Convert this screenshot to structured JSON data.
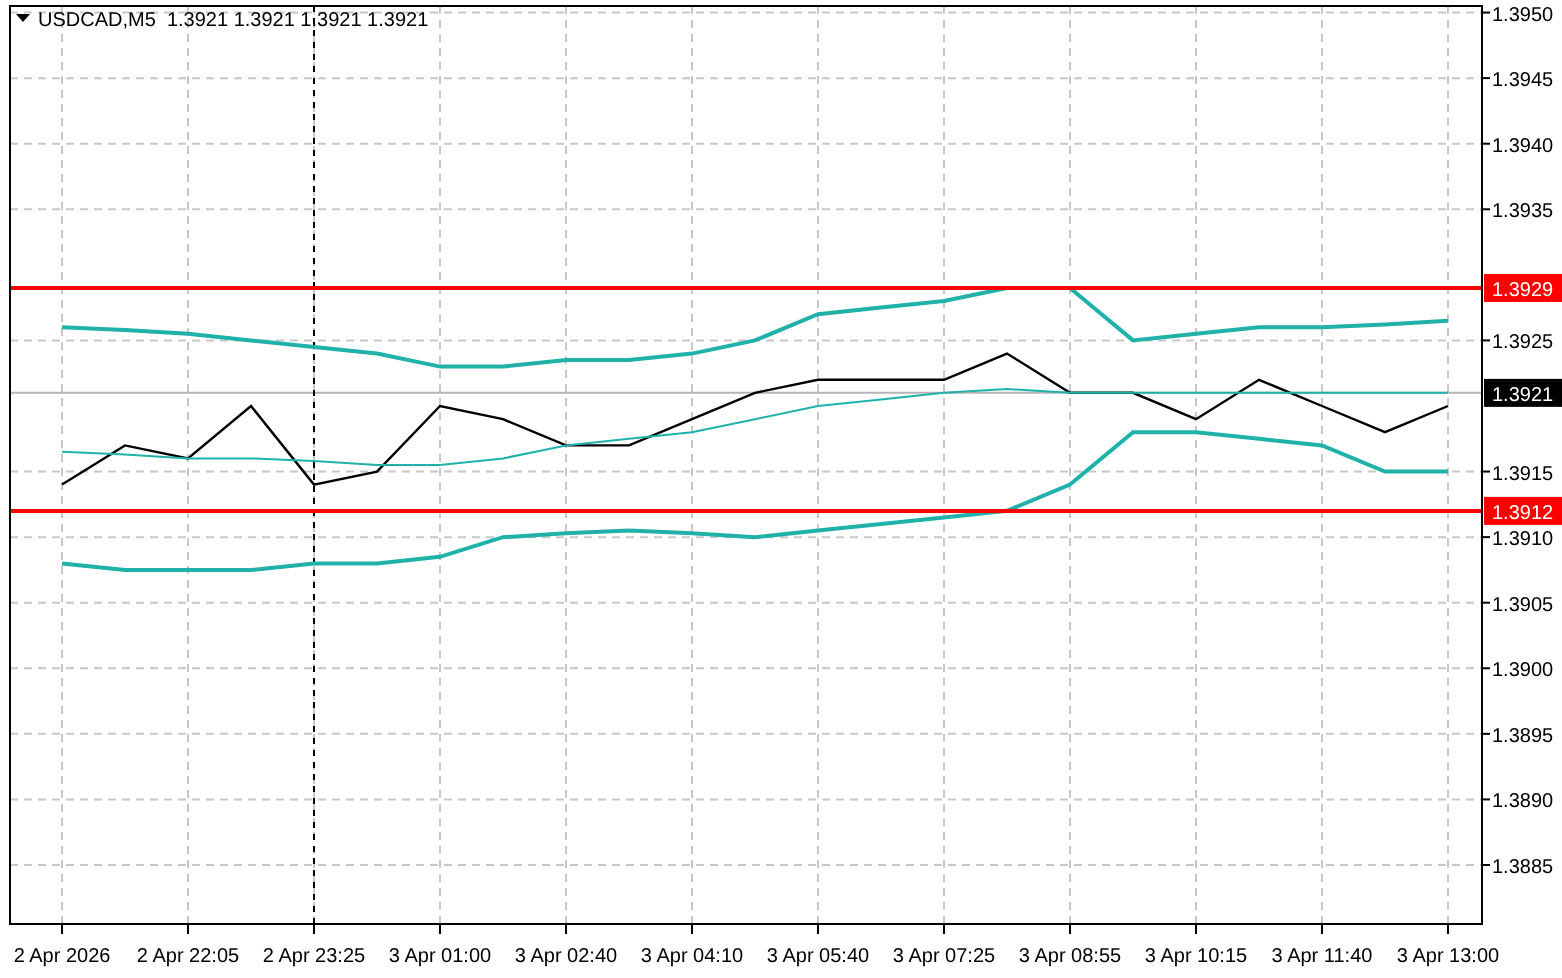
{
  "chart": {
    "header": {
      "symbol": "USDCAD,M5",
      "ohlc": [
        "1.3921",
        "1.3921",
        "1.3921",
        "1.3921"
      ]
    },
    "chart_data": {
      "type": "line",
      "categories": [
        "2 Apr 2026",
        null,
        "2 Apr 22:05",
        null,
        "2 Apr 23:25",
        null,
        "3 Apr 01:00",
        null,
        "3 Apr 02:40",
        null,
        "3 Apr 04:10",
        null,
        "3 Apr 05:40",
        null,
        "3 Apr 07:25",
        null,
        "3 Apr 08:55",
        null,
        "3 Apr 10:15",
        null,
        "3 Apr 11:40",
        null,
        "3 Apr 13:00"
      ],
      "ylim": [
        1.38805,
        1.39505
      ],
      "series": [
        {
          "color": "#000000",
          "values": [
            1.3914,
            1.3917,
            1.3916,
            1.392,
            1.3914,
            1.3915,
            1.392,
            1.3919,
            1.3917,
            1.3917,
            1.3919,
            1.3921,
            1.3922,
            1.3922,
            1.3922,
            1.3924,
            1.3921,
            1.3921,
            1.3919,
            1.3922,
            1.392,
            1.3918,
            1.392
          ]
        },
        {
          "color": "#20b2aa",
          "values": [
            1.3926,
            1.39258,
            1.39255,
            1.3925,
            1.39245,
            1.3924,
            1.3923,
            1.3923,
            1.39235,
            1.39235,
            1.3924,
            1.3925,
            1.3927,
            1.39275,
            1.3928,
            1.3929,
            1.3929,
            1.3925,
            1.39255,
            1.3926,
            1.3926,
            1.39262,
            1.39265
          ]
        },
        {
          "color": "#20b2aa",
          "values": [
            1.39165,
            1.39163,
            1.3916,
            1.3916,
            1.39158,
            1.39155,
            1.39155,
            1.3916,
            1.3917,
            1.39175,
            1.3918,
            1.3919,
            1.392,
            1.39205,
            1.3921,
            1.39213,
            1.3921,
            1.3921,
            1.3921,
            1.3921,
            1.3921,
            1.3921,
            1.3921
          ]
        },
        {
          "color": "#20b2aa",
          "values": [
            1.3908,
            1.39075,
            1.39075,
            1.39075,
            1.3908,
            1.3908,
            1.39085,
            1.391,
            1.39103,
            1.39105,
            1.39103,
            1.391,
            1.39105,
            1.3911,
            1.39115,
            1.3912,
            1.3914,
            1.3918,
            1.3918,
            1.39175,
            1.3917,
            1.3915,
            1.3915
          ]
        }
      ],
      "yticks": [
        {
          "value": 1.395,
          "label": "1.3950"
        },
        {
          "value": 1.3945,
          "label": "1.3945"
        },
        {
          "value": 1.394,
          "label": "1.3940"
        },
        {
          "value": 1.3935,
          "label": "1.3935"
        },
        {
          "value": 1.3925,
          "label": "1.3925"
        },
        {
          "value": 1.3915,
          "label": "1.3915"
        },
        {
          "value": 1.391,
          "label": "1.3910"
        },
        {
          "value": 1.3905,
          "label": "1.3905"
        },
        {
          "value": 1.39,
          "label": "1.3900"
        },
        {
          "value": 1.3895,
          "label": "1.3895"
        },
        {
          "value": 1.389,
          "label": "1.3890"
        },
        {
          "value": 1.3885,
          "label": "1.3885"
        }
      ],
      "grid": true,
      "ref_lines": [
        {
          "axis": "y",
          "value": 1.3929,
          "color": "#ff0000"
        },
        {
          "axis": "y",
          "value": 1.3921,
          "color": "#b4b4b4"
        },
        {
          "axis": "y",
          "value": 1.3912,
          "color": "#ff0000"
        },
        {
          "axis": "x",
          "value": "2 Apr 23:25",
          "color": "#000000"
        }
      ]
    },
    "price_tags": [
      {
        "kind": "level",
        "label": "1.3929"
      },
      {
        "kind": "bid",
        "label": "1.3921"
      },
      {
        "kind": "level",
        "label": "1.3912"
      }
    ]
  }
}
